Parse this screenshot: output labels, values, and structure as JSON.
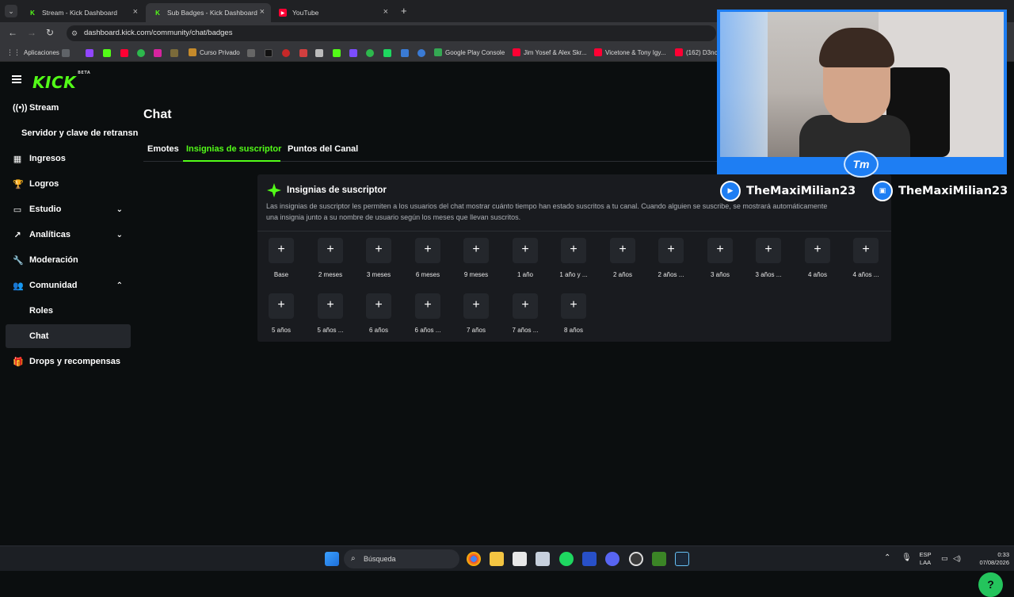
{
  "browser": {
    "tabs": [
      {
        "label": "Stream - Kick Dashboard",
        "active": false
      },
      {
        "label": "Sub Badges - Kick Dashboard",
        "active": true
      },
      {
        "label": "YouTube",
        "active": false
      }
    ],
    "new_tab": "+",
    "url": "dashboard.kick.com/community/chat/badges",
    "bookmarks": {
      "apps": "Aplicaciones",
      "curso": "Curso Privado",
      "google_play": "Google Play Console",
      "jim_yosef": "Jim Yosef & Alex Skr...",
      "vicetone": "Vicetone & Tony Igy...",
      "d3": "(162) D3nc"
    }
  },
  "app": {
    "logo": "KICK",
    "logo_sup": "BETA",
    "sidebar": {
      "stream": "Stream",
      "servidor": "Servidor y clave de retransn",
      "ingresos": "Ingresos",
      "logros": "Logros",
      "estudio": "Estudio",
      "analiticas": "Analíticas",
      "moderacion": "Moderación",
      "comunidad": "Comunidad",
      "roles": "Roles",
      "chat": "Chat",
      "drops": "Drops y recompensas"
    },
    "page_title": "Chat",
    "tabs": {
      "emotes": "Emotes",
      "insignias": "Insignias de suscriptor",
      "puntos": "Puntos del Canal"
    },
    "card": {
      "title": "Insignias de suscriptor",
      "description": "Las insignias de suscriptor les permiten a los usuarios del chat mostrar cuánto tiempo han estado suscritos a tu canal. Cuando alguien se suscribe, se mostrará automáticamente una insignia junto a su nombre de usuario según los meses que llevan suscritos.",
      "badges": [
        "Base",
        "2 meses",
        "3 meses",
        "6 meses",
        "9 meses",
        "1 año",
        "1 año y ...",
        "2 años",
        "2 años ...",
        "3 años",
        "3 años ...",
        "4 años",
        "4 años ...",
        "5 años",
        "5 años ...",
        "6 años",
        "6 años ...",
        "7 años",
        "7 años ...",
        "8 años"
      ]
    }
  },
  "overlay": {
    "cam_logo": "Tm",
    "youtube_name": "TheMaxiMilian23",
    "twitch_name": "TheMaxiMilian23"
  },
  "taskbar": {
    "search": "Búsqueda",
    "lang_top": "ESP",
    "lang_bottom": "LAA",
    "time": "0:33",
    "date": "07/08/2026"
  },
  "colors": {
    "kick_green": "#53fc18",
    "background": "#0b0e0f",
    "card": "#191b1f",
    "help_button": "#24c45c"
  }
}
